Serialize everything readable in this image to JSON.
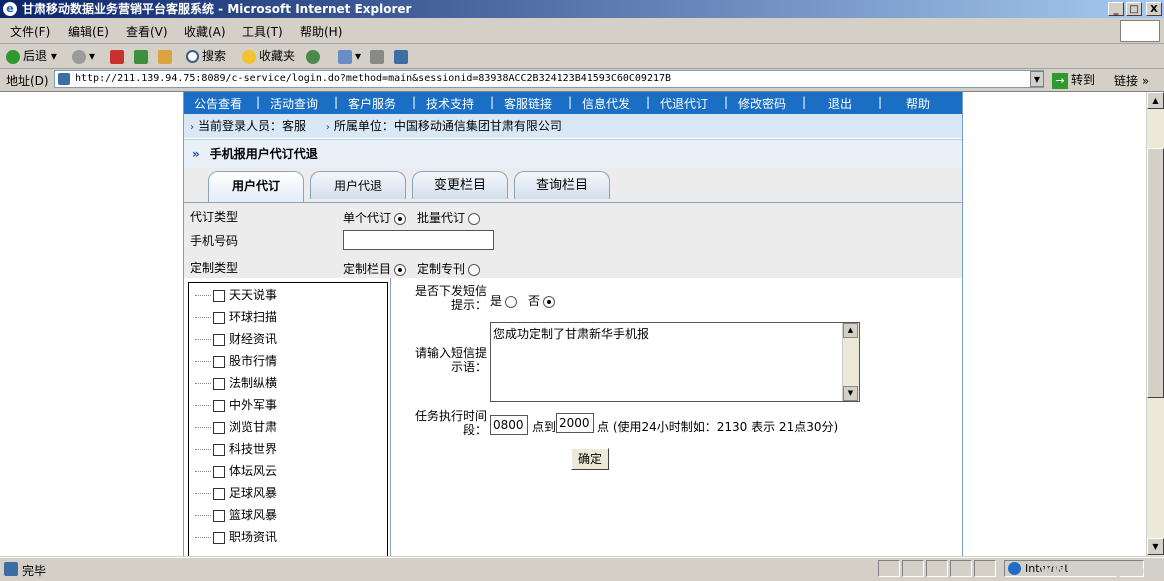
{
  "window": {
    "title": "甘肃移动数据业务营销平台客服系统 - Microsoft Internet Explorer",
    "min": "_",
    "max": "□",
    "close": "X"
  },
  "menu": [
    "文件(F)",
    "编辑(E)",
    "查看(V)",
    "收藏(A)",
    "工具(T)",
    "帮助(H)"
  ],
  "toolbar": {
    "back": "后退",
    "search": "搜索",
    "favorites": "收藏夹"
  },
  "address": {
    "label": "地址(D)",
    "url": "http://211.139.94.75:8089/c-service/login.do?method=main&sessionid=83938ACC2B324123B41593C60C09217B",
    "go": "转到",
    "links": "链接"
  },
  "topnav": [
    "公告查看",
    "活动查询",
    "客户服务",
    "技术支持",
    "客服链接",
    "信息代发",
    "代退代订",
    "修改密码",
    "退出",
    "帮助"
  ],
  "login_bar": {
    "user": "当前登录人员：客服",
    "unit": "所属单位：中国移动通信集团甘肃有限公司"
  },
  "section_title": "手机报用户代订代退",
  "tabs": [
    "用户代订",
    "用户代退",
    "变更栏目",
    "查询栏目"
  ],
  "form": {
    "order_type_label": "代订类型",
    "single_label": "单个代订",
    "batch_label": "批量代订",
    "phone_label": "手机号码",
    "phone_value": "",
    "custom_type_label": "定制类型",
    "column_label": "定制栏目",
    "issue_label": "定制专刊"
  },
  "columns": [
    "天天说事",
    "环球扫描",
    "财经资讯",
    "股市行情",
    "法制纵横",
    "中外军事",
    "浏览甘肃",
    "科技世界",
    "体坛风云",
    "足球风暴",
    "篮球风暴",
    "职场资讯"
  ],
  "sms": {
    "send_label_1": "是否下发短信",
    "send_label_2": "提示：",
    "yes": "是",
    "no": "否",
    "prompt_label_1": "请输入短信提",
    "prompt_label_2": "示语：",
    "prompt_value": "您成功定制了甘肃新华手机报",
    "time_label_1": "任务执行时间",
    "time_label_2": "段：",
    "start_time": "0800",
    "to_label": "点到",
    "end_time": "2000",
    "time_hint": "点 (使用24小时制如：2130 表示  21点30分)",
    "confirm": "确定"
  },
  "status": {
    "text": "完毕",
    "zone": "Internet"
  },
  "watermark": "www.wooyun.org"
}
